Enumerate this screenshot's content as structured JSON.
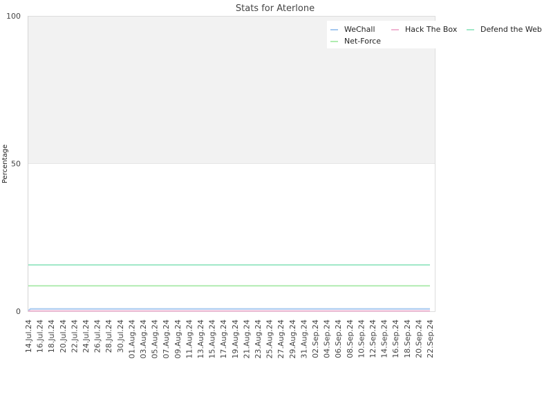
{
  "chart_data": {
    "type": "line",
    "title": "Stats for Aterlone",
    "xlabel": "",
    "ylabel": "Percentage",
    "ylim": [
      0,
      100
    ],
    "yticks": [
      "0",
      "50",
      "100"
    ],
    "ytick_values": [
      0,
      50,
      100
    ],
    "grid": true,
    "upper_band_fill": "#f2f2f2",
    "legend_placement": "top-right",
    "x": [
      "14.Jul.24",
      "16.Jul.24",
      "18.Jul.24",
      "20.Jul.24",
      "22.Jul.24",
      "24.Jul.24",
      "26.Jul.24",
      "28.Jul.24",
      "30.Jul.24",
      "01.Aug.24",
      "03.Aug.24",
      "05.Aug.24",
      "07.Aug.24",
      "09.Aug.24",
      "11.Aug.24",
      "13.Aug.24",
      "15.Aug.24",
      "17.Aug.24",
      "19.Aug.24",
      "21.Aug.24",
      "23.Aug.24",
      "25.Aug.24",
      "27.Aug.24",
      "29.Aug.24",
      "31.Aug.24",
      "02.Sep.24",
      "04.Sep.24",
      "06.Sep.24",
      "08.Sep.24",
      "10.Sep.24",
      "12.Sep.24",
      "14.Sep.24",
      "16.Sep.24",
      "18.Sep.24",
      "20.Sep.24",
      "22.Sep.24"
    ],
    "series": [
      {
        "name": "WeChall",
        "color": "#a4c8f0",
        "start": 0.2,
        "value": 0.8
      },
      {
        "name": "Hack The Box",
        "color": "#f0b4d2",
        "start": 0.1,
        "value": 0.1
      },
      {
        "name": "Defend the Web",
        "color": "#a0e8c8",
        "start": 15.7,
        "value": 15.7
      },
      {
        "name": "Net-Force",
        "color": "#b0ecb0",
        "start": 8.6,
        "value": 8.6
      }
    ]
  }
}
